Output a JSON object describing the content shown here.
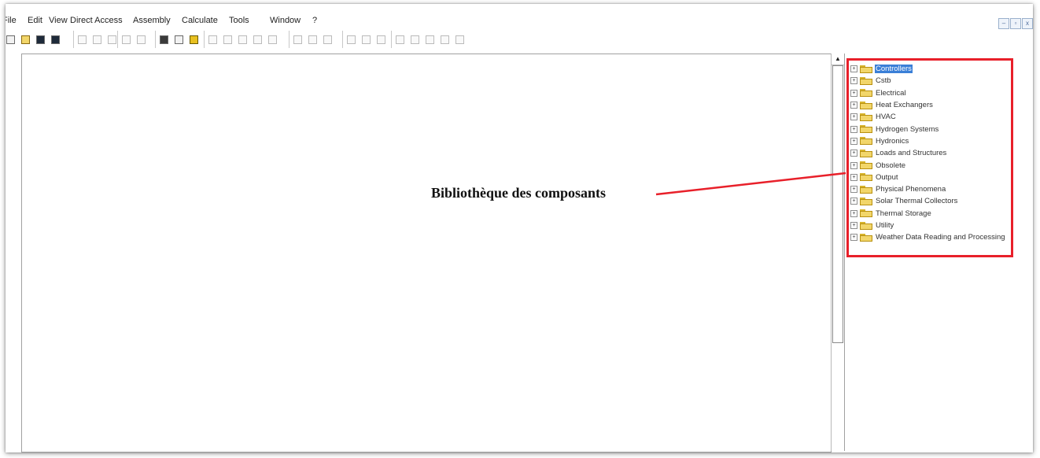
{
  "menu": [
    "File",
    "Edit",
    "View",
    "Direct Access",
    "Assembly",
    "Calculate",
    "Tools",
    "Window",
    "?"
  ],
  "window_controls": [
    "–",
    "▫",
    "x"
  ],
  "toolbar_groups": [
    {
      "icons": [
        "new-icon",
        "open-icon",
        "save-icon",
        "save-all-icon"
      ]
    },
    {
      "icons": [
        "cut-icon",
        "copy-icon",
        "paste-icon"
      ]
    },
    {
      "icons": [
        "undo-icon",
        "redo-icon"
      ]
    },
    {
      "icons": [
        "print-icon",
        "print-preview-icon",
        "help-icon"
      ]
    },
    {
      "icons": [
        "align-top-icon",
        "align-bottom-icon",
        "align-center-icon",
        "align-middle-icon",
        "align-connections-icon"
      ]
    },
    {
      "icons": [
        "distribute-left-icon",
        "distribute-center-icon",
        "distribute-right-icon"
      ]
    },
    {
      "icons": [
        "distribute-top-icon",
        "distribute-middle-icon",
        "distribute-bottom-icon"
      ]
    },
    {
      "icons": [
        "same-width-icon",
        "same-height-icon",
        "same-size-icon",
        "grid-icon",
        "snap-icon"
      ]
    }
  ],
  "library": {
    "selected_index": 0,
    "items": [
      "Controllers",
      "Cstb",
      "Electrical",
      "Heat Exchangers",
      "HVAC",
      "Hydrogen Systems",
      "Hydronics",
      "Loads and Structures",
      "Obsolete",
      "Output",
      "Physical Phenomena",
      "Solar Thermal Collectors",
      "Thermal Storage",
      "Utility",
      "Weather Data Reading and Processing"
    ]
  },
  "annotation": {
    "text": "Bibliothèque des composants",
    "color": "#e8202a"
  },
  "colors": {
    "selection": "#3a7fd7",
    "highlight_border": "#e8202a",
    "folder": "#f2d66a"
  }
}
